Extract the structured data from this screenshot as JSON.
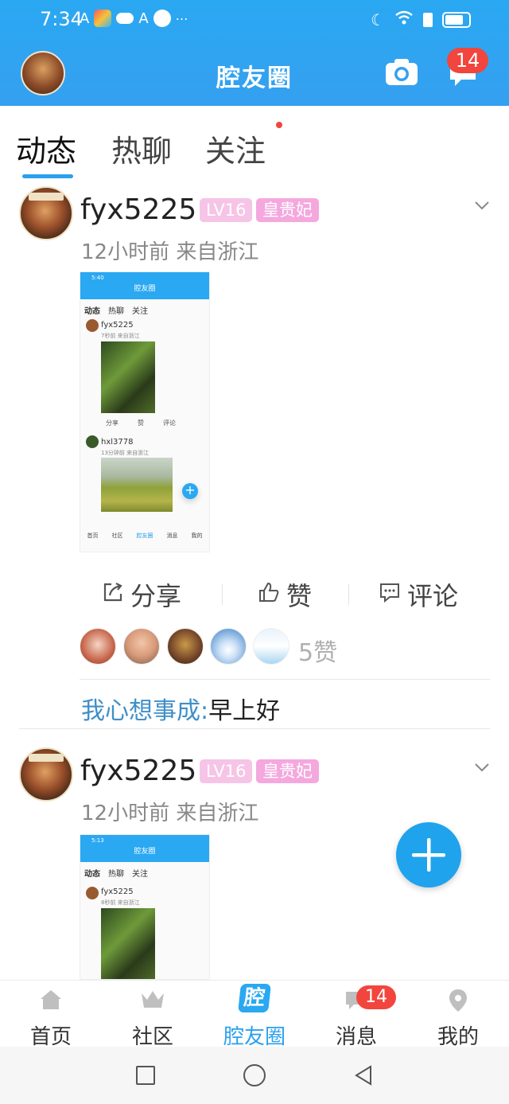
{
  "status": {
    "time": "7:34"
  },
  "header": {
    "title": "腔友圈",
    "badge": "14"
  },
  "tabs": [
    {
      "label": "动态",
      "active": true
    },
    {
      "label": "热聊",
      "active": false
    },
    {
      "label": "关注",
      "active": false,
      "dot": true
    }
  ],
  "posts": [
    {
      "user": "fyx5225",
      "level": "LV16",
      "rank": "皇贵妃",
      "meta": "12小时前 来自浙江",
      "shot": {
        "time": "5:40",
        "title": "腔友圈",
        "tabs": [
          "动态",
          "热聊",
          "关注"
        ],
        "u1": "fyx5225",
        "u1meta": "7秒前 来自浙江",
        "acts": [
          "分享",
          "赞",
          "评论"
        ],
        "u2": "hxl3778",
        "u2meta": "13分钟前 来自浙江",
        "nav": [
          "首页",
          "社区",
          "腔友圈",
          "消息",
          "我的"
        ]
      },
      "actions": {
        "share": "分享",
        "like": "赞",
        "comment": "评论"
      },
      "likes": "5赞",
      "comment_user": "我心想事成:",
      "comment_text": "早上好"
    },
    {
      "user": "fyx5225",
      "level": "LV16",
      "rank": "皇贵妃",
      "meta": "12小时前 来自浙江",
      "shot": {
        "time": "5:13",
        "title": "腔友圈",
        "tabs": [
          "动态",
          "热聊",
          "关注"
        ],
        "u1": "fyx5225",
        "u1meta": "8秒前 来自浙江"
      }
    }
  ],
  "bottom_nav": [
    {
      "label": "首页",
      "icon": "home-icon"
    },
    {
      "label": "社区",
      "icon": "crown-icon"
    },
    {
      "label": "腔友圈",
      "icon": "qiang-icon",
      "active": true,
      "icon_text": "腔"
    },
    {
      "label": "消息",
      "icon": "message-icon",
      "badge": "14"
    },
    {
      "label": "我的",
      "icon": "location-pin-icon"
    }
  ],
  "colors": {
    "accent": "#2aa8f2",
    "badge": "#f2453d",
    "level_bg": "#f6c4e6",
    "rank_bg": "#f4a8de",
    "comment_user": "#3e8fc8"
  }
}
